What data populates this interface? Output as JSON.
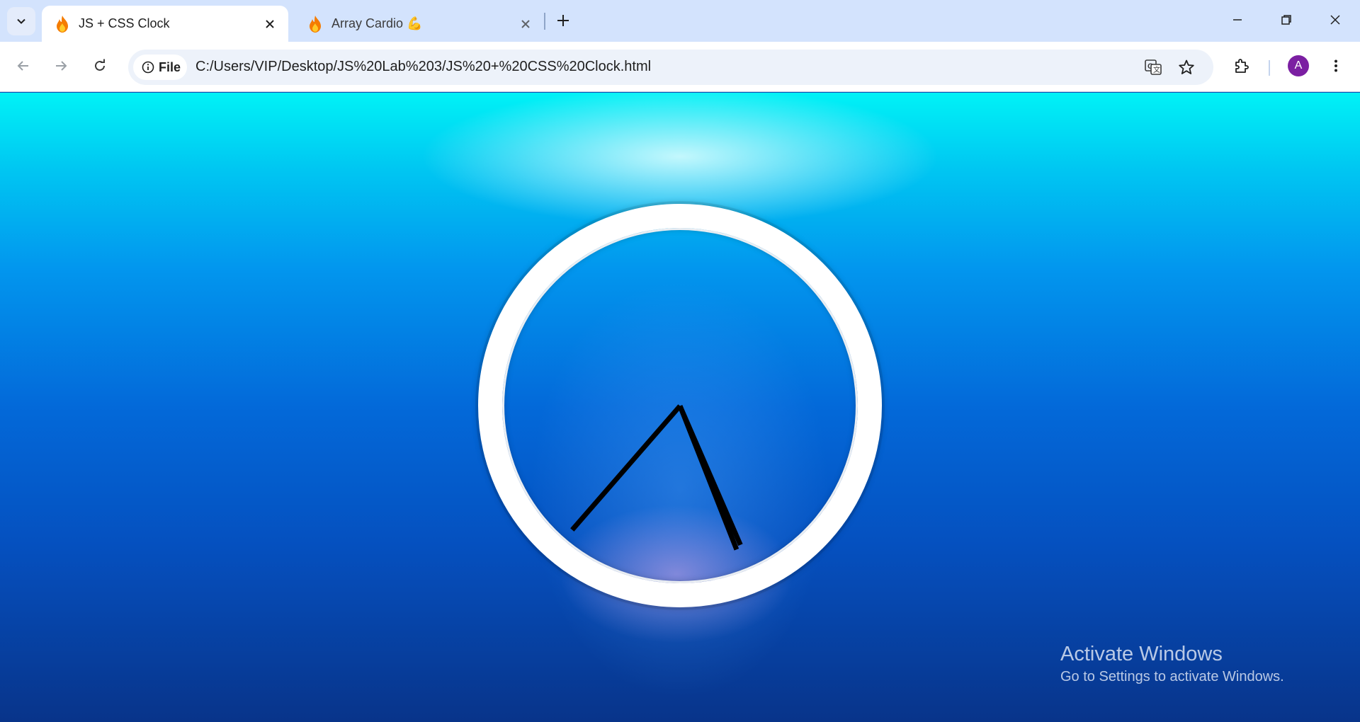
{
  "browser": {
    "tabs": [
      {
        "title": "JS + CSS Clock",
        "active": true,
        "favicon": "fire-icon"
      },
      {
        "title": "Array Cardio 💪",
        "active": false,
        "favicon": "fire-icon"
      }
    ],
    "address": {
      "chip_label": "File",
      "url": "C:/Users/VIP/Desktop/JS%20Lab%203/JS%20+%20CSS%20Clock.html"
    },
    "profile_initial": "A",
    "accent_color": "#d3e3fd"
  },
  "clock": {
    "hands": [
      "hour-hand",
      "minute-hand",
      "second-hand"
    ]
  },
  "watermark": {
    "line1": "Activate Windows",
    "line2": "Go to Settings to activate Windows."
  }
}
